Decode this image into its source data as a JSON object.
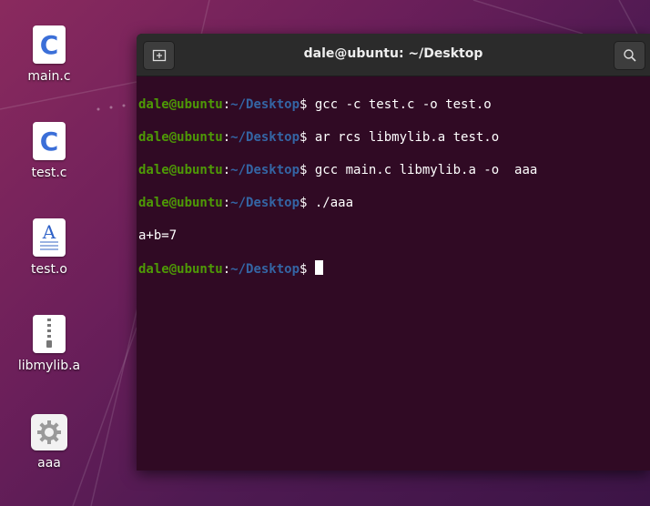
{
  "desktop": {
    "icons": [
      {
        "label": "main.c",
        "glyph": "C",
        "icon": "c-source-file-icon"
      },
      {
        "label": "test.c",
        "glyph": "C",
        "icon": "c-source-file-icon"
      },
      {
        "label": "test.o",
        "glyph": "A",
        "icon": "document-text-icon"
      },
      {
        "label": "libmylib.a",
        "icon": "archive-zip-icon"
      },
      {
        "label": "aaa",
        "icon": "executable-gear-icon"
      }
    ]
  },
  "terminal": {
    "title": "dale@ubuntu: ~/Desktop",
    "user_host": "dale@ubuntu",
    "path": "~/Desktop",
    "lines": [
      {
        "type": "cmd",
        "user": "dale@ubuntu",
        "path": "~/Desktop",
        "command": "gcc -c test.c -o test.o"
      },
      {
        "type": "cmd",
        "user": "dale@ubuntu",
        "path": "~/Desktop",
        "command": "ar rcs libmylib.a test.o"
      },
      {
        "type": "cmd",
        "user": "dale@ubuntu",
        "path": "~/Desktop",
        "command": "gcc main.c libmylib.a -o  aaa"
      },
      {
        "type": "cmd",
        "user": "dale@ubuntu",
        "path": "~/Desktop",
        "command": "./aaa"
      },
      {
        "type": "out",
        "text": "a+b=7"
      },
      {
        "type": "prompt",
        "user": "dale@ubuntu",
        "path": "~/Desktop",
        "command": ""
      }
    ]
  },
  "colors": {
    "terminal_bg": "#300a24",
    "prompt_user": "#4e9a06",
    "prompt_path": "#3465a4"
  }
}
